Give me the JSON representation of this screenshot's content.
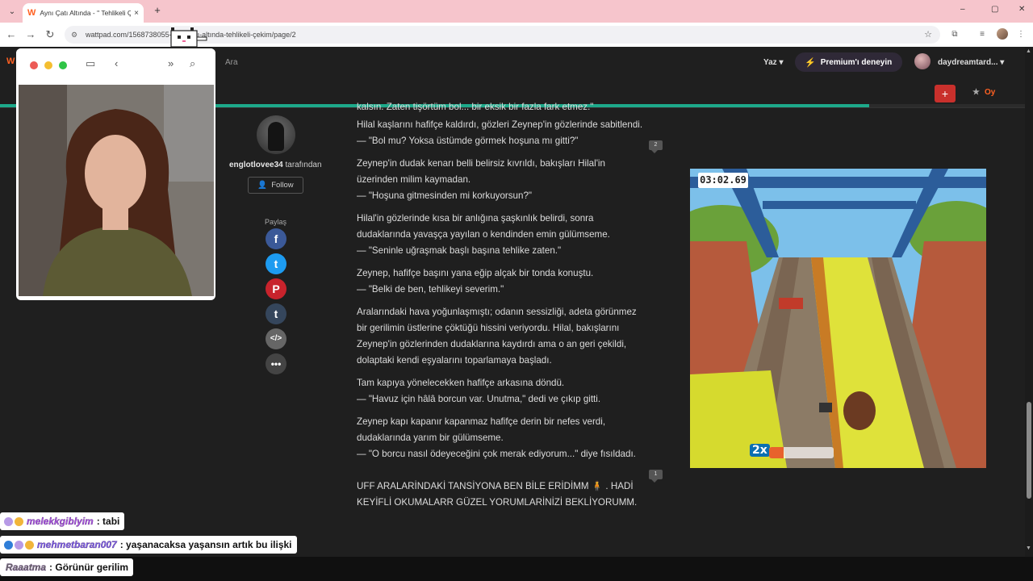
{
  "browser": {
    "tab": {
      "title": "Aynı Çatı Altında - \" Tehlikeli Çe",
      "close": "×"
    },
    "new_tab": "+",
    "url": "wattpad.com/1568738055-aynı-çatı-altında-tehlikeli-çekim/page/2",
    "window_controls": [
      "–",
      "▢",
      "✕"
    ]
  },
  "header": {
    "logo": "W",
    "search_placeholder": "Ara",
    "write": "Yaz ▾",
    "premium": "Premium'ı deneyin",
    "username": "daydreamtard... ▾"
  },
  "toolbar": {
    "add": "+",
    "vote": "Oy",
    "progress_fraction": 0.848
  },
  "author": {
    "name": "englotlovee34",
    "suffix": " tarafından",
    "follow": "Follow",
    "share_label": "Paylaş",
    "share_icons": [
      "facebook-icon",
      "twitter-icon",
      "pinterest-icon",
      "tumblr-icon",
      "embed-icon",
      "more-icon"
    ]
  },
  "story": {
    "partial_top": "kalsın. Zaten tişörtüm bol... bir eksik bir fazla fark etmez.\"",
    "paragraphs": [
      [
        "Hilal kaşlarını hafifçe kaldırdı, gözleri Zeynep'in gözlerinde sabitlendi.",
        "— \"Bol mu? Yoksa üstümde görmek hoşuna mı gitti?\""
      ],
      [
        "Zeynep'in dudak kenarı belli belirsiz kıvrıldı, bakışları Hilal'in üzerinden milim kaymadan.",
        "— \"Hoşuna gitmesinden mi korkuyorsun?\""
      ],
      [
        "Hilal'in gözlerinde kısa bir anlığına şaşkınlık belirdi, sonra dudaklarında yavaşça yayılan o kendinden emin gülümseme.",
        "— \"Seninle uğraşmak başlı başına tehlike zaten.\""
      ],
      [
        "Zeynep, hafifçe başını yana eğip alçak bir tonda konuştu.",
        "— \"Belki de ben, tehlikeyi severim.\""
      ],
      [
        "Aralarındaki hava yoğunlaşmıştı; odanın sessizliği, adeta görünmez bir gerilimin üstlerine çöktüğü hissini veriyordu. Hilal, bakışlarını Zeynep'in gözlerinden dudaklarına kaydırdı ama o an geri çekildi, dolaptaki kendi eşyalarını toparlamaya başladı."
      ],
      [
        "Tam kapıya yönelecekken hafifçe arkasına döndü.",
        "— \"Havuz için hâlâ borcun var. Unutma,\" dedi ve çıkıp gitti."
      ],
      [
        "Zeynep kapı kapanır kapanmaz hafifçe derin bir nefes verdi, dudaklarında yarım bir gülümseme.",
        "— \"O borcu nasıl ödeyeceğini çok merak ediyorum...\" diye fısıldadı."
      ]
    ],
    "author_note": "UFF ARALARİNDAKİ TANSİYONA BEN BİLE ERİDİMM 🧍 . HADİ KEYİFLİ OKUMALARR GÜZEL YORUMLARİNİZİ BEKLİYORUMM.",
    "comment_counts": [
      "2",
      "1"
    ]
  },
  "game": {
    "timer": "03:02.69",
    "multiplier": "2x",
    "boost_fraction": 0.22
  },
  "chat": [
    {
      "user": "melekkgiblyim",
      "message": ": tabi"
    },
    {
      "user": "mehmetbaran007",
      "message": ": yaşanacaksa yaşansın artık bu ilişki"
    },
    {
      "user": "Raaatma",
      "message": ": Görünür gerilim"
    }
  ],
  "colors": {
    "accent": "#ff6122",
    "progress": "#1da98a",
    "premium_bolt": "#d645e6"
  }
}
